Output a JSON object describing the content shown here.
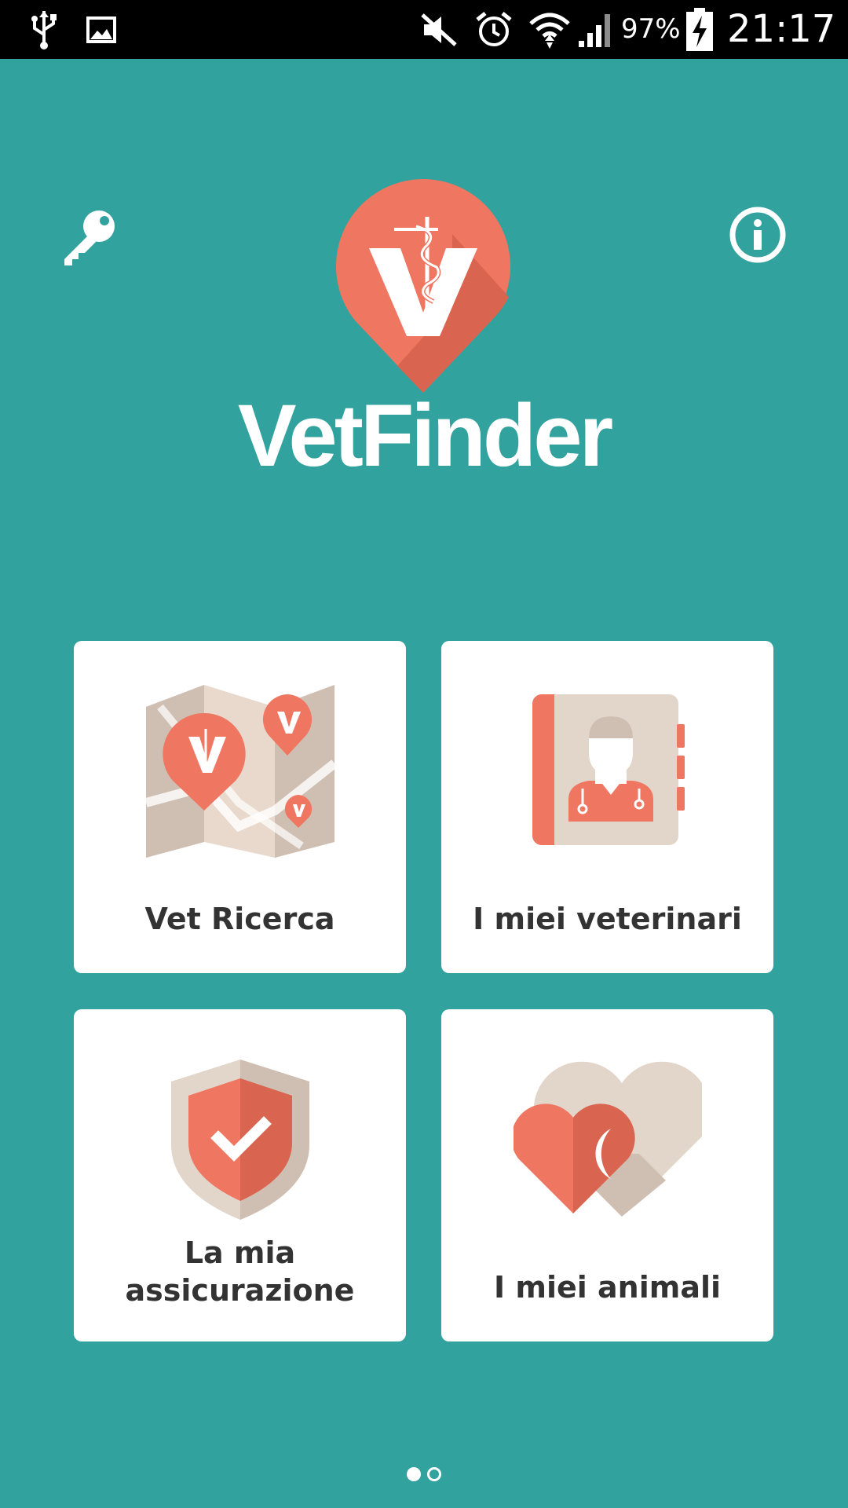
{
  "status_bar": {
    "battery_percent": "97%",
    "time": "21:17",
    "icons": [
      "usb-icon",
      "image-icon",
      "mute-icon",
      "alarm-icon",
      "wifi-icon",
      "signal-icon",
      "battery-charging-icon"
    ]
  },
  "header": {
    "left_icon": "key-icon",
    "right_icon": "info-icon"
  },
  "logo": {
    "title": "VetFinder",
    "brand_color": "#ef7661",
    "background_color": "#31a29d"
  },
  "tiles": [
    {
      "label": "Vet Ricerca",
      "icon": "map-search-icon"
    },
    {
      "label": "I miei veterinari",
      "icon": "vet-contacts-icon"
    },
    {
      "label_line1": "La mia",
      "label_line2": "assicurazione",
      "icon": "insurance-shield-icon"
    },
    {
      "label": "I miei animali",
      "icon": "hearts-icon"
    }
  ],
  "pagination": {
    "pages": 2,
    "current": 1
  }
}
